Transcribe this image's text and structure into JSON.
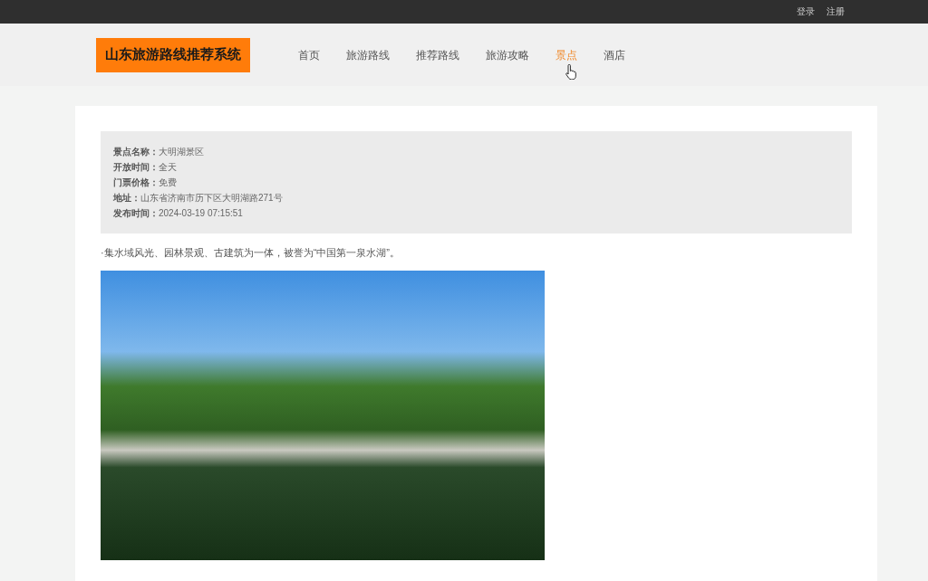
{
  "top_bar": {
    "links": [
      {
        "label": "登录"
      },
      {
        "label": "注册"
      }
    ]
  },
  "header": {
    "logo": "山东旅游路线推荐系统",
    "nav": [
      {
        "label": "首页",
        "selected": false
      },
      {
        "label": "旅游路线",
        "selected": false
      },
      {
        "label": "推荐路线",
        "selected": false
      },
      {
        "label": "旅游攻略",
        "selected": false
      },
      {
        "label": "景点",
        "selected": true
      },
      {
        "label": "酒店",
        "selected": false
      }
    ]
  },
  "attraction": {
    "details": [
      {
        "label": "景点名称：",
        "value": "大明湖景区"
      },
      {
        "label": "开放时间：",
        "value": "全天"
      },
      {
        "label": "门票价格：",
        "value": "免费"
      },
      {
        "label": "地址：",
        "value": "山东省济南市历下区大明湖路271号"
      },
      {
        "label": "发布时间：",
        "value": "2024-03-19 07:15:51"
      }
    ],
    "description": "·集水域风光、园林景观、古建筑为一体，被誉为“中国第一泉水湖”。"
  }
}
